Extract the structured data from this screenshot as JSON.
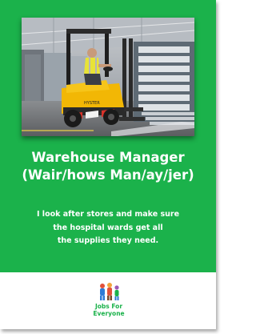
{
  "poster": {
    "title_line1": "Warehouse Manager",
    "title_line2": "(Wair/hows Man/ay/jer)",
    "description_lines": [
      "I look after stores and make sure",
      "the hospital wards get all",
      "the supplies they need."
    ]
  },
  "brand": {
    "line1": "Jobs For",
    "line2": "Everyone"
  },
  "image": {
    "subject": "forklift-in-warehouse"
  },
  "colors": {
    "accent_green": "#1bb24b",
    "text_on_green": "#ffffff"
  }
}
